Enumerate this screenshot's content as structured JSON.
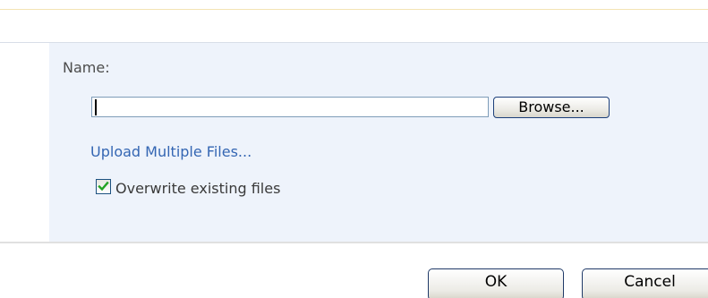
{
  "form": {
    "name_label": "Name:",
    "file_value": "",
    "browse_label": "Browse...",
    "upload_multiple_link": "Upload Multiple Files...",
    "overwrite_label": "Overwrite existing files",
    "overwrite_checked": true
  },
  "footer": {
    "ok_label": "OK",
    "cancel_label": "Cancel"
  },
  "icons": {
    "checkbox_mark": "checkmark-icon"
  },
  "colors": {
    "panel_background": "#eef3fb",
    "link": "#3466b3",
    "checkmark": "#22a322"
  }
}
